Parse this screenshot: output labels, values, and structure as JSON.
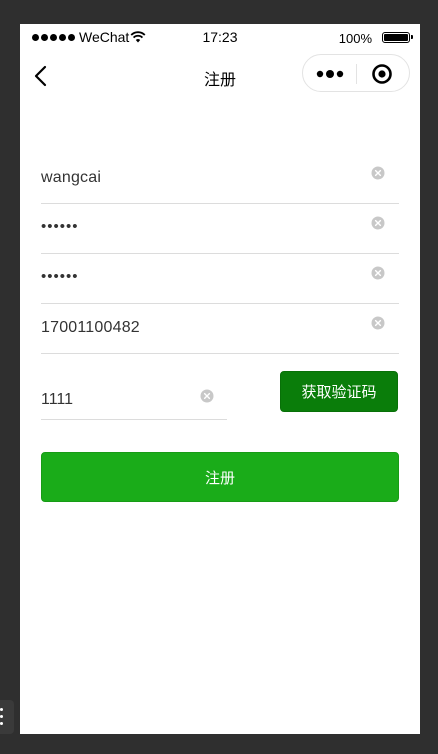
{
  "status_bar": {
    "carrier": "WeChat",
    "time": "17:23",
    "battery": "100%"
  },
  "navbar": {
    "title": "注册",
    "back_icon": "chevron-left-icon",
    "menu_icon": "more-dots-icon",
    "close_icon": "target-icon"
  },
  "form": {
    "username": "wangcai",
    "password": "••••••",
    "confirm_password": "••••••",
    "phone": "17001100482",
    "verify_code": "1111",
    "get_code_label": "获取验证码",
    "submit_label": "注册"
  },
  "colors": {
    "primary_green": "#1aac19",
    "dark_green": "#0a7d0a",
    "background": "#2f2f2f"
  }
}
